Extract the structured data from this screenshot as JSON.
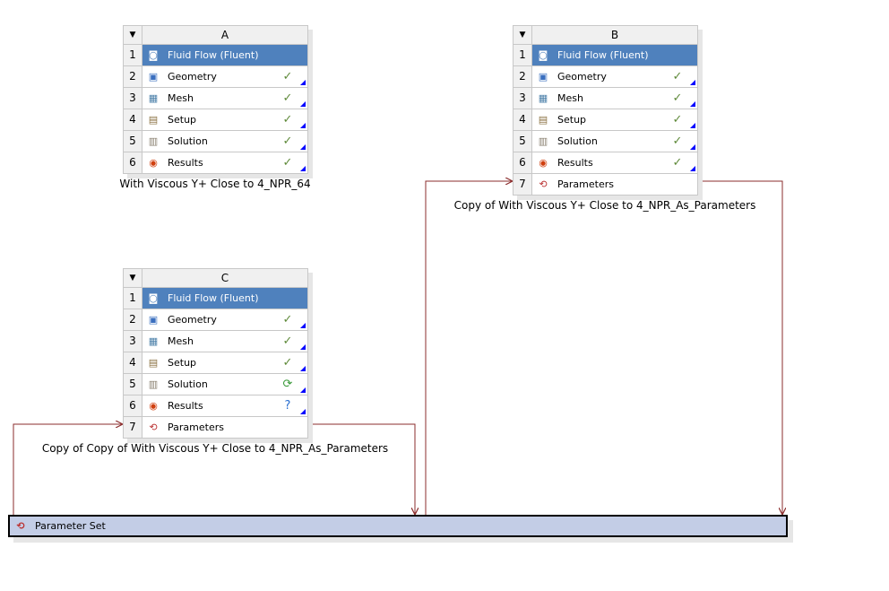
{
  "colors": {
    "selected": "#4f81bd",
    "wire": "#8b2d2d",
    "check": "#5f8a3a",
    "param_set_bg": "#c3cde6"
  },
  "systems": [
    {
      "id": "A",
      "letter": "A",
      "caption": "With Viscous Y+ Close to 4_NPR_64",
      "rows": [
        {
          "num": "1",
          "label": "Fluid Flow (Fluent)",
          "icon": "fluent-icon",
          "status": "",
          "selected": true
        },
        {
          "num": "2",
          "label": "Geometry",
          "icon": "geometry-icon",
          "status": "check-icon"
        },
        {
          "num": "3",
          "label": "Mesh",
          "icon": "mesh-icon",
          "status": "check-icon"
        },
        {
          "num": "4",
          "label": "Setup",
          "icon": "setup-icon",
          "status": "check-icon"
        },
        {
          "num": "5",
          "label": "Solution",
          "icon": "solution-icon",
          "status": "check-icon"
        },
        {
          "num": "6",
          "label": "Results",
          "icon": "results-icon",
          "status": "check-icon"
        }
      ]
    },
    {
      "id": "B",
      "letter": "B",
      "caption": "Copy of With Viscous Y+ Close to 4_NPR_As_Parameters",
      "rows": [
        {
          "num": "1",
          "label": "Fluid Flow (Fluent)",
          "icon": "fluent-icon",
          "status": "",
          "selected": true
        },
        {
          "num": "2",
          "label": "Geometry",
          "icon": "geometry-icon",
          "status": "check-icon"
        },
        {
          "num": "3",
          "label": "Mesh",
          "icon": "mesh-icon",
          "status": "check-icon"
        },
        {
          "num": "4",
          "label": "Setup",
          "icon": "setup-icon",
          "status": "check-icon"
        },
        {
          "num": "5",
          "label": "Solution",
          "icon": "solution-icon",
          "status": "check-icon"
        },
        {
          "num": "6",
          "label": "Results",
          "icon": "results-icon",
          "status": "check-icon"
        },
        {
          "num": "7",
          "label": "Parameters",
          "icon": "parameters-icon",
          "status": ""
        }
      ]
    },
    {
      "id": "C",
      "letter": "C",
      "caption": "Copy of Copy of With Viscous Y+ Close to 4_NPR_As_Parameters",
      "rows": [
        {
          "num": "1",
          "label": "Fluid Flow (Fluent)",
          "icon": "fluent-icon",
          "status": "",
          "selected": true
        },
        {
          "num": "2",
          "label": "Geometry",
          "icon": "geometry-icon",
          "status": "check-icon"
        },
        {
          "num": "3",
          "label": "Mesh",
          "icon": "mesh-icon",
          "status": "check-icon"
        },
        {
          "num": "4",
          "label": "Setup",
          "icon": "setup-icon",
          "status": "check-icon"
        },
        {
          "num": "5",
          "label": "Solution",
          "icon": "solution-icon",
          "status": "refresh-icon"
        },
        {
          "num": "6",
          "label": "Results",
          "icon": "results-icon",
          "status": "question-icon"
        },
        {
          "num": "7",
          "label": "Parameters",
          "icon": "parameters-icon",
          "status": ""
        }
      ]
    }
  ],
  "parameter_set": {
    "label": "Parameter Set",
    "icon": "parameter-set-icon"
  }
}
